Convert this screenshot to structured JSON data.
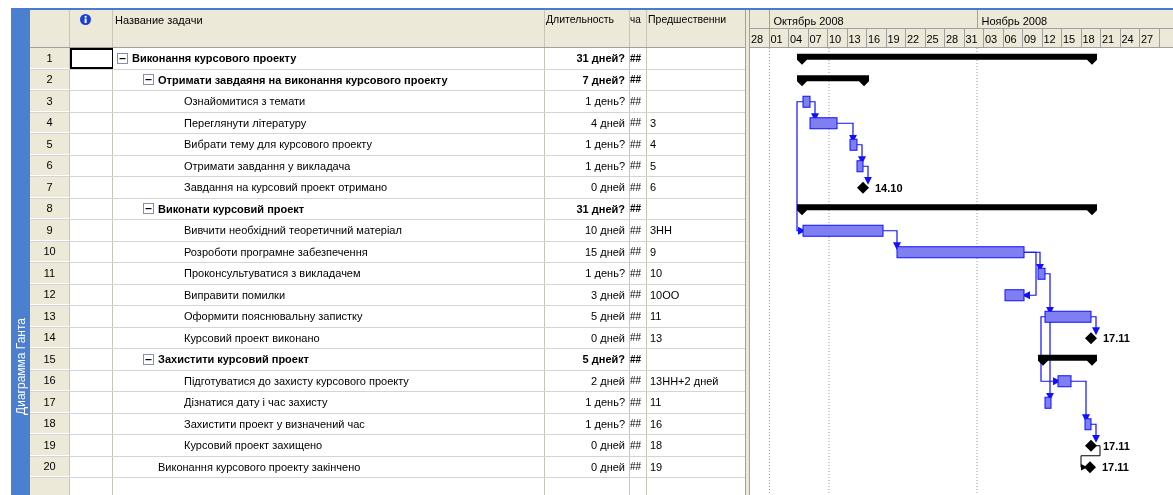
{
  "side_tab": {
    "label": "Диаграмма Ганта"
  },
  "table": {
    "columns": [
      "Название задачи",
      "Длительность",
      "ча",
      "Предшественни"
    ],
    "rows": [
      {
        "id": "1",
        "name": "Виконання курсового проекту",
        "duration": "31 дней?",
        "column_4": "##",
        "expanded": true,
        "active": true,
        "gantt": {
          "kind": "summary"
        },
        "children": [
          {
            "id": "2",
            "name": "Отримати завдаяня на виконання курсового проекту",
            "duration": "7 дней?",
            "column_4": "##",
            "expanded": true,
            "active": false,
            "gantt": {
              "kind": "summary"
            },
            "children": [
              {
                "id": "3",
                "name": "Ознайомитися з темати",
                "duration": "1 день?",
                "column_4": "##",
                "active": false,
                "gantt": {
                  "kind": "task"
                }
              },
              {
                "id": "4",
                "name": "Переглянути літературу",
                "duration": "4 дней",
                "column_4": "##",
                "predecessors": "3",
                "active": false,
                "gantt": {
                  "kind": "task"
                }
              },
              {
                "id": "5",
                "name": "Вибрати тему для курсового проекту",
                "duration": "1 день?",
                "column_4": "##",
                "predecessors": "4",
                "active": false,
                "gantt": {
                  "kind": "task"
                }
              },
              {
                "id": "6",
                "name": "Отримати завдання у викладача",
                "duration": "1 день?",
                "column_4": "##",
                "predecessors": "5",
                "active": false,
                "gantt": {
                  "kind": "task"
                }
              },
              {
                "id": "7",
                "name": "Завдання на курсовий проект отримано",
                "duration": "0 дней",
                "column_4": "##",
                "predecessors": "6",
                "active": false,
                "gantt": {
                  "kind": "milestone",
                  "label": "14.10"
                }
              }
            ]
          },
          {
            "id": "8",
            "name": "Виконати курсовий проект",
            "duration": "31 дней?",
            "column_4": "##",
            "expanded": true,
            "active": false,
            "gantt": {
              "kind": "summary"
            },
            "children": [
              {
                "id": "9",
                "name": "Вивчити необхідний теоретичний матеріал",
                "duration": "10 дней",
                "column_4": "##",
                "predecessors": "3НН",
                "active": false,
                "gantt": {
                  "kind": "task"
                }
              },
              {
                "id": "10",
                "name": "Розроботи програмне забезпечення",
                "duration": "15 дней",
                "column_4": "##",
                "predecessors": "9",
                "active": false,
                "gantt": {
                  "kind": "task"
                }
              },
              {
                "id": "11",
                "name": "Проконсультуватися з викладачем",
                "duration": "1 день?",
                "column_4": "##",
                "predecessors": "10",
                "active": false,
                "gantt": {
                  "kind": "task"
                }
              },
              {
                "id": "12",
                "name": "Виправити помилки",
                "duration": "3 дней",
                "column_4": "##",
                "predecessors": "10ОО",
                "active": false,
                "gantt": {
                  "kind": "task"
                }
              },
              {
                "id": "13",
                "name": "Оформити пояснювальну запистку",
                "duration": "5 дней",
                "column_4": "##",
                "predecessors": "11",
                "active": false,
                "gantt": {
                  "kind": "task"
                }
              },
              {
                "id": "14",
                "name": "Курсовий проект виконано",
                "duration": "0 дней",
                "column_4": "##",
                "predecessors": "13",
                "active": false,
                "gantt": {
                  "kind": "milestone",
                  "label": "17.11"
                }
              }
            ]
          },
          {
            "id": "15",
            "name": "Захистити курсовий проект",
            "duration": "5 дней?",
            "column_4": "##",
            "expanded": true,
            "active": false,
            "gantt": {
              "kind": "summary"
            },
            "children": [
              {
                "id": "16",
                "name": "Підготуватися до захисту курсового проекту",
                "duration": "2 дней",
                "column_4": "##",
                "predecessors": "13НН+2 дней",
                "active": false,
                "gantt": {
                  "kind": "task"
                }
              },
              {
                "id": "17",
                "name": "Дізнатися дату і час захисту",
                "duration": "1 день?",
                "column_4": "##",
                "predecessors": "11",
                "active": false,
                "gantt": {
                  "kind": "task"
                }
              },
              {
                "id": "18",
                "name": "Захистити проект у визначений час",
                "duration": "1 день?",
                "column_4": "##",
                "predecessors": "16",
                "active": false,
                "gantt": {
                  "kind": "task"
                }
              },
              {
                "id": "19",
                "name": "Курсовий проект захищено",
                "duration": "0 дней",
                "column_4": "##",
                "predecessors": "18",
                "active": false,
                "gantt": {
                  "kind": "milestone",
                  "label": "17.11"
                }
              }
            ]
          },
          {
            "id": "20",
            "name": "Виконання курсового проекту закінчено",
            "duration": "0 дней",
            "column_4": "##",
            "predecessors": "19",
            "active": false,
            "gantt": {
              "kind": "milestone",
              "label": "17.11"
            }
          }
        ]
      }
    ]
  },
  "timescale": {
    "months": [
      "Октябрь 2008",
      "Ноябрь 2008"
    ],
    "days": [
      "28",
      "01",
      "04",
      "07",
      "10",
      "13",
      "16",
      "19",
      "22",
      "25",
      "28",
      "31",
      "03",
      "06",
      "09",
      "12",
      "15",
      "18",
      "21",
      "24",
      "27"
    ]
  }
}
